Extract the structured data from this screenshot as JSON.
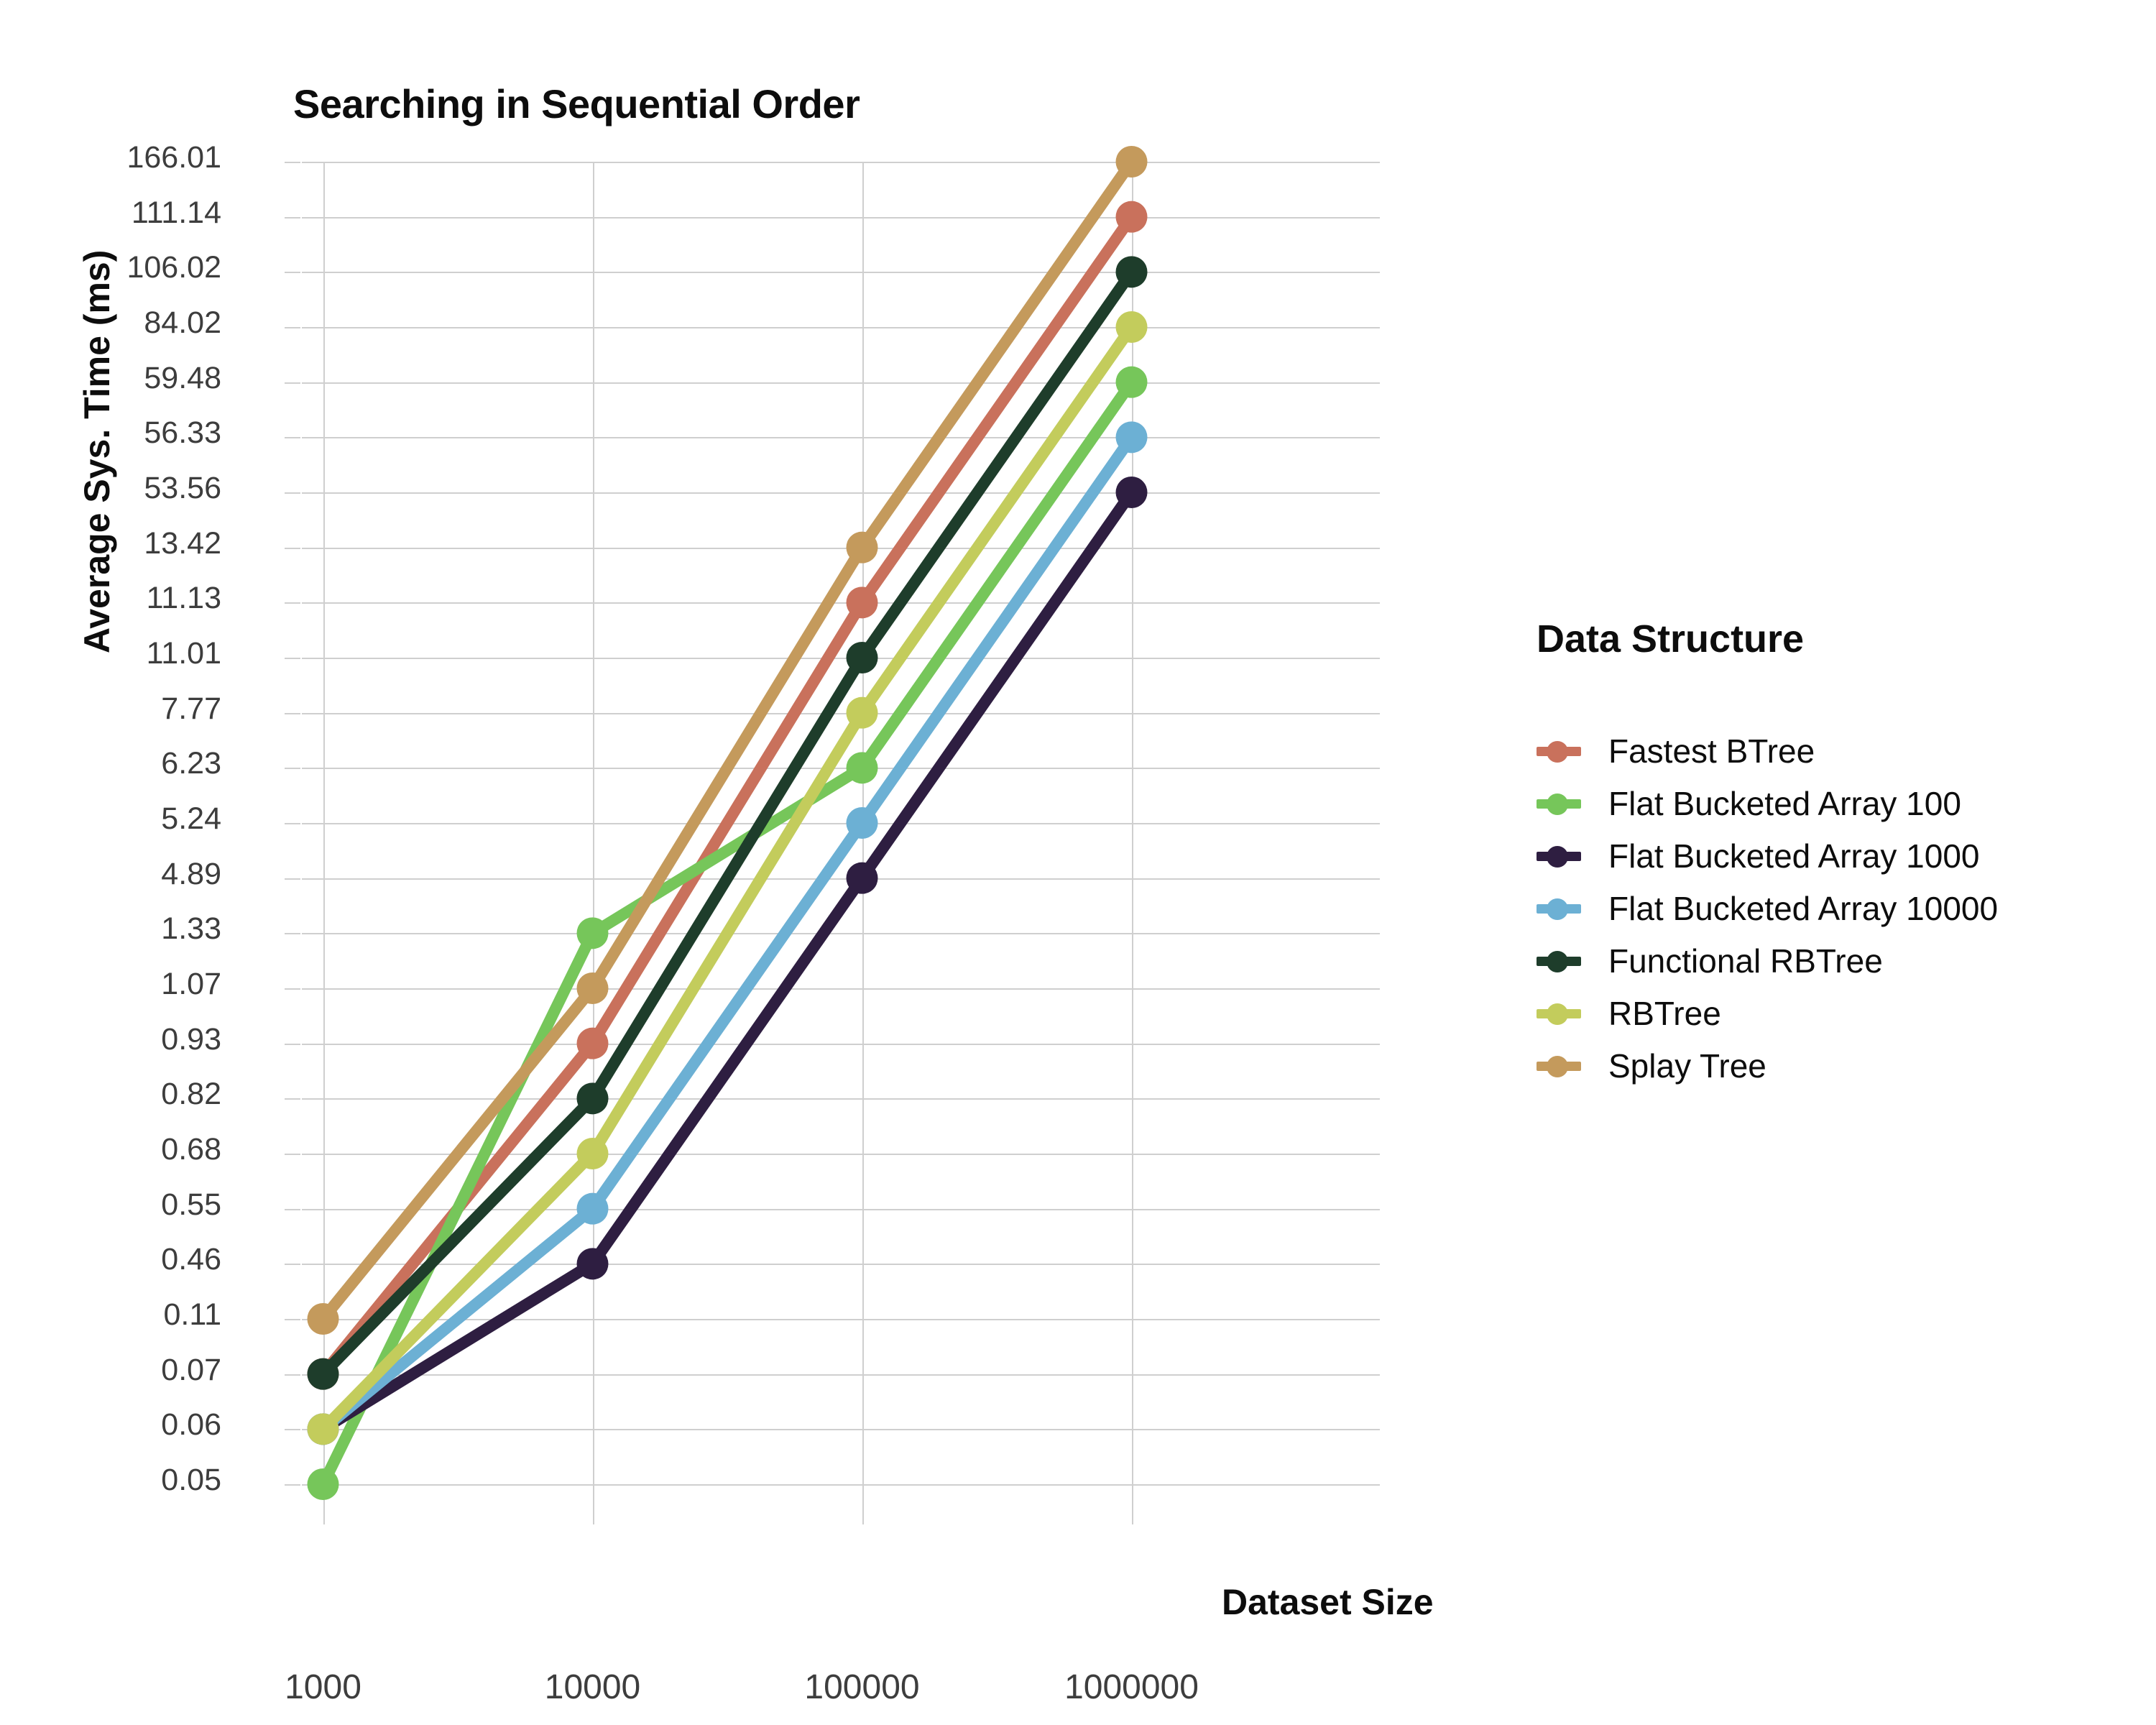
{
  "chart_data": {
    "type": "line",
    "title": "Searching in Sequential Order",
    "xlabel": "Dataset Size",
    "ylabel": "Average Sys. Time (ms)",
    "legend_title": "Data Structure",
    "legend_position": "right",
    "grid": true,
    "x_scale": "ordinal-log",
    "y_scale": "ordinal",
    "categories": [
      "1000",
      "10000",
      "100000",
      "1000000"
    ],
    "x_tick_labels": [
      "1000",
      "10000",
      "100000",
      "1000000"
    ],
    "y_tick_labels": [
      "166.01",
      "111.14",
      "106.02",
      "84.02",
      "59.48",
      "56.33",
      "53.56",
      "13.42",
      "11.13",
      "11.01",
      "7.77",
      "6.23",
      "5.24",
      "4.89",
      "1.33",
      "1.07",
      "0.93",
      "0.82",
      "0.68",
      "0.55",
      "0.46",
      "0.11",
      "0.07",
      "0.06",
      "0.05"
    ],
    "y_tick_values": [
      166.01,
      111.14,
      106.02,
      84.02,
      59.48,
      56.33,
      53.56,
      13.42,
      11.13,
      11.01,
      7.77,
      6.23,
      5.24,
      4.89,
      1.33,
      1.07,
      0.93,
      0.82,
      0.68,
      0.55,
      0.46,
      0.11,
      0.07,
      0.06,
      0.05
    ],
    "series": [
      {
        "name": "Fastest BTree",
        "color": "#c9715c",
        "values": [
          0.07,
          0.93,
          11.13,
          111.14
        ]
      },
      {
        "name": "Flat Bucketed Array 100",
        "color": "#76c65a",
        "values": [
          0.05,
          1.33,
          6.23,
          59.48
        ]
      },
      {
        "name": "Flat Bucketed Array 1000",
        "color": "#2e1e41",
        "values": [
          0.06,
          0.46,
          4.89,
          53.56
        ]
      },
      {
        "name": "Flat Bucketed Array 10000",
        "color": "#6cb0d4",
        "values": [
          0.06,
          0.55,
          5.24,
          56.33
        ]
      },
      {
        "name": "Functional RBTree",
        "color": "#1e3d2b",
        "values": [
          0.07,
          0.82,
          11.01,
          106.02
        ]
      },
      {
        "name": "RBTree",
        "color": "#c3cc5c",
        "values": [
          0.06,
          0.68,
          7.77,
          84.02
        ]
      },
      {
        "name": "Splay Tree",
        "color": "#c49a5c",
        "values": [
          0.11,
          1.07,
          13.42,
          166.01
        ]
      }
    ]
  },
  "colors": {
    "grid": "#cfcfcf",
    "tick_text": "#3d3d3d",
    "title_text": "#0d0d0d",
    "background": "#ffffff"
  }
}
